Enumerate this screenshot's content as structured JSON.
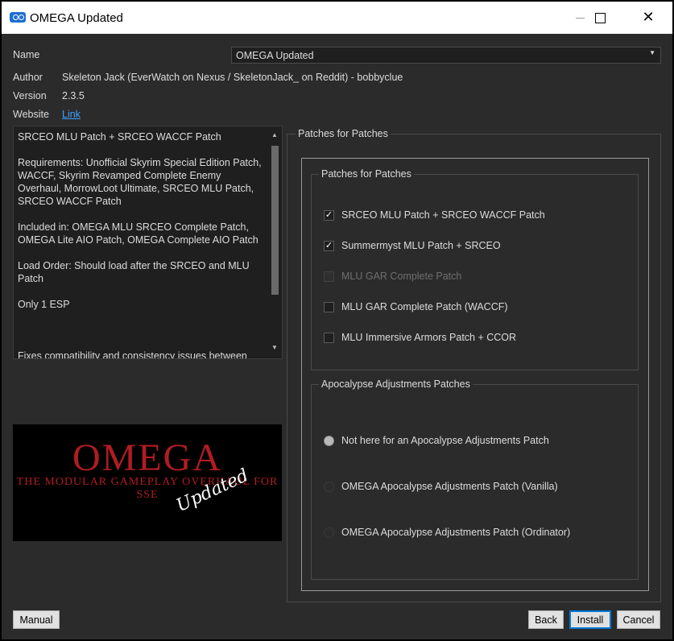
{
  "window": {
    "title": "OMEGA Updated",
    "close_glyph": "✕"
  },
  "info": {
    "name_label": "Name",
    "name_value": "OMEGA Updated",
    "author_label": "Author",
    "author_value": "Skeleton Jack (EverWatch on Nexus / SkeletonJack_ on Reddit) - bobbyclue",
    "version_label": "Version",
    "version_value": "2.3.5",
    "website_label": "Website",
    "website_link": "Link"
  },
  "description": {
    "paragraphs": [
      "SRCEO MLU Patch + SRCEO WACCF Patch",
      "Requirements: Unofficial Skyrim Special Edition Patch, WACCF, Skyrim Revamped Complete Enemy Overhaul, MorrowLoot Ultimate, SRCEO MLU Patch, SRCEO WACCF Patch",
      "Included in: OMEGA MLU SRCEO Complete Patch, OMEGA Lite AIO Patch, OMEGA Complete AIO Patch",
      "Load Order: Should load after the SRCEO and MLU Patch",
      "Only 1 ESP",
      "",
      "Fixes compatibility and consistency issues between"
    ]
  },
  "banner": {
    "title": "OMEGA",
    "subtitle": "THE MODULAR GAMEPLAY OVERHAUL FOR SSE",
    "overlay": "Updated"
  },
  "step": {
    "title": "Patches for Patches",
    "groups": [
      {
        "title": "Patches for Patches",
        "options": [
          {
            "label": "SRCEO MLU Patch + SRCEO WACCF Patch",
            "checked": true,
            "enabled": true
          },
          {
            "label": "Summermyst MLU Patch + SRCEO",
            "checked": true,
            "enabled": true
          },
          {
            "label": "MLU GAR Complete Patch",
            "checked": false,
            "enabled": false
          },
          {
            "label": "MLU GAR Complete Patch (WACCF)",
            "checked": false,
            "enabled": true
          },
          {
            "label": "MLU Immersive Armors Patch + CCOR",
            "checked": false,
            "enabled": true
          }
        ]
      },
      {
        "title": "Apocalypse Adjustments Patches",
        "options": [
          {
            "label": "Not here for an Apocalypse Adjustments Patch",
            "selected": true
          },
          {
            "label": "OMEGA Apocalypse Adjustments Patch (Vanilla)",
            "selected": false
          },
          {
            "label": "OMEGA Apocalypse Adjustments Patch (Ordinator)",
            "selected": false
          }
        ]
      }
    ]
  },
  "buttons": {
    "manual": "Manual",
    "back": "Back",
    "install": "Install",
    "cancel": "Cancel"
  },
  "colors": {
    "accent": "#0078d7",
    "link": "#3ea3ff",
    "banner_red": "#b01c22"
  },
  "icons": {
    "app": "mo2-app-icon",
    "check": "checkmark-icon",
    "dropdown": "chevron-down-icon"
  }
}
